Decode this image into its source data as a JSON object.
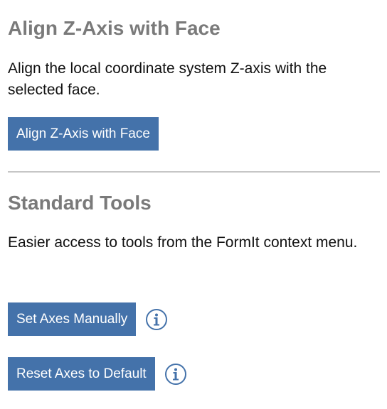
{
  "align": {
    "heading": "Align Z-Axis with Face",
    "description": "Align the local coordinate system Z-axis with the selected face.",
    "button_label": "Align Z-Axis with Face"
  },
  "standard": {
    "heading": "Standard Tools",
    "description": "Easier access to tools from the FormIt context menu.",
    "set_axes_label": "Set Axes Manually",
    "reset_axes_label": "Reset Axes to Default"
  },
  "colors": {
    "button": "#4472aa",
    "heading": "#7a7a7a",
    "icon": "#4472aa",
    "divider": "#c6c6c6"
  },
  "icons": {
    "info": "info-circle-icon"
  }
}
